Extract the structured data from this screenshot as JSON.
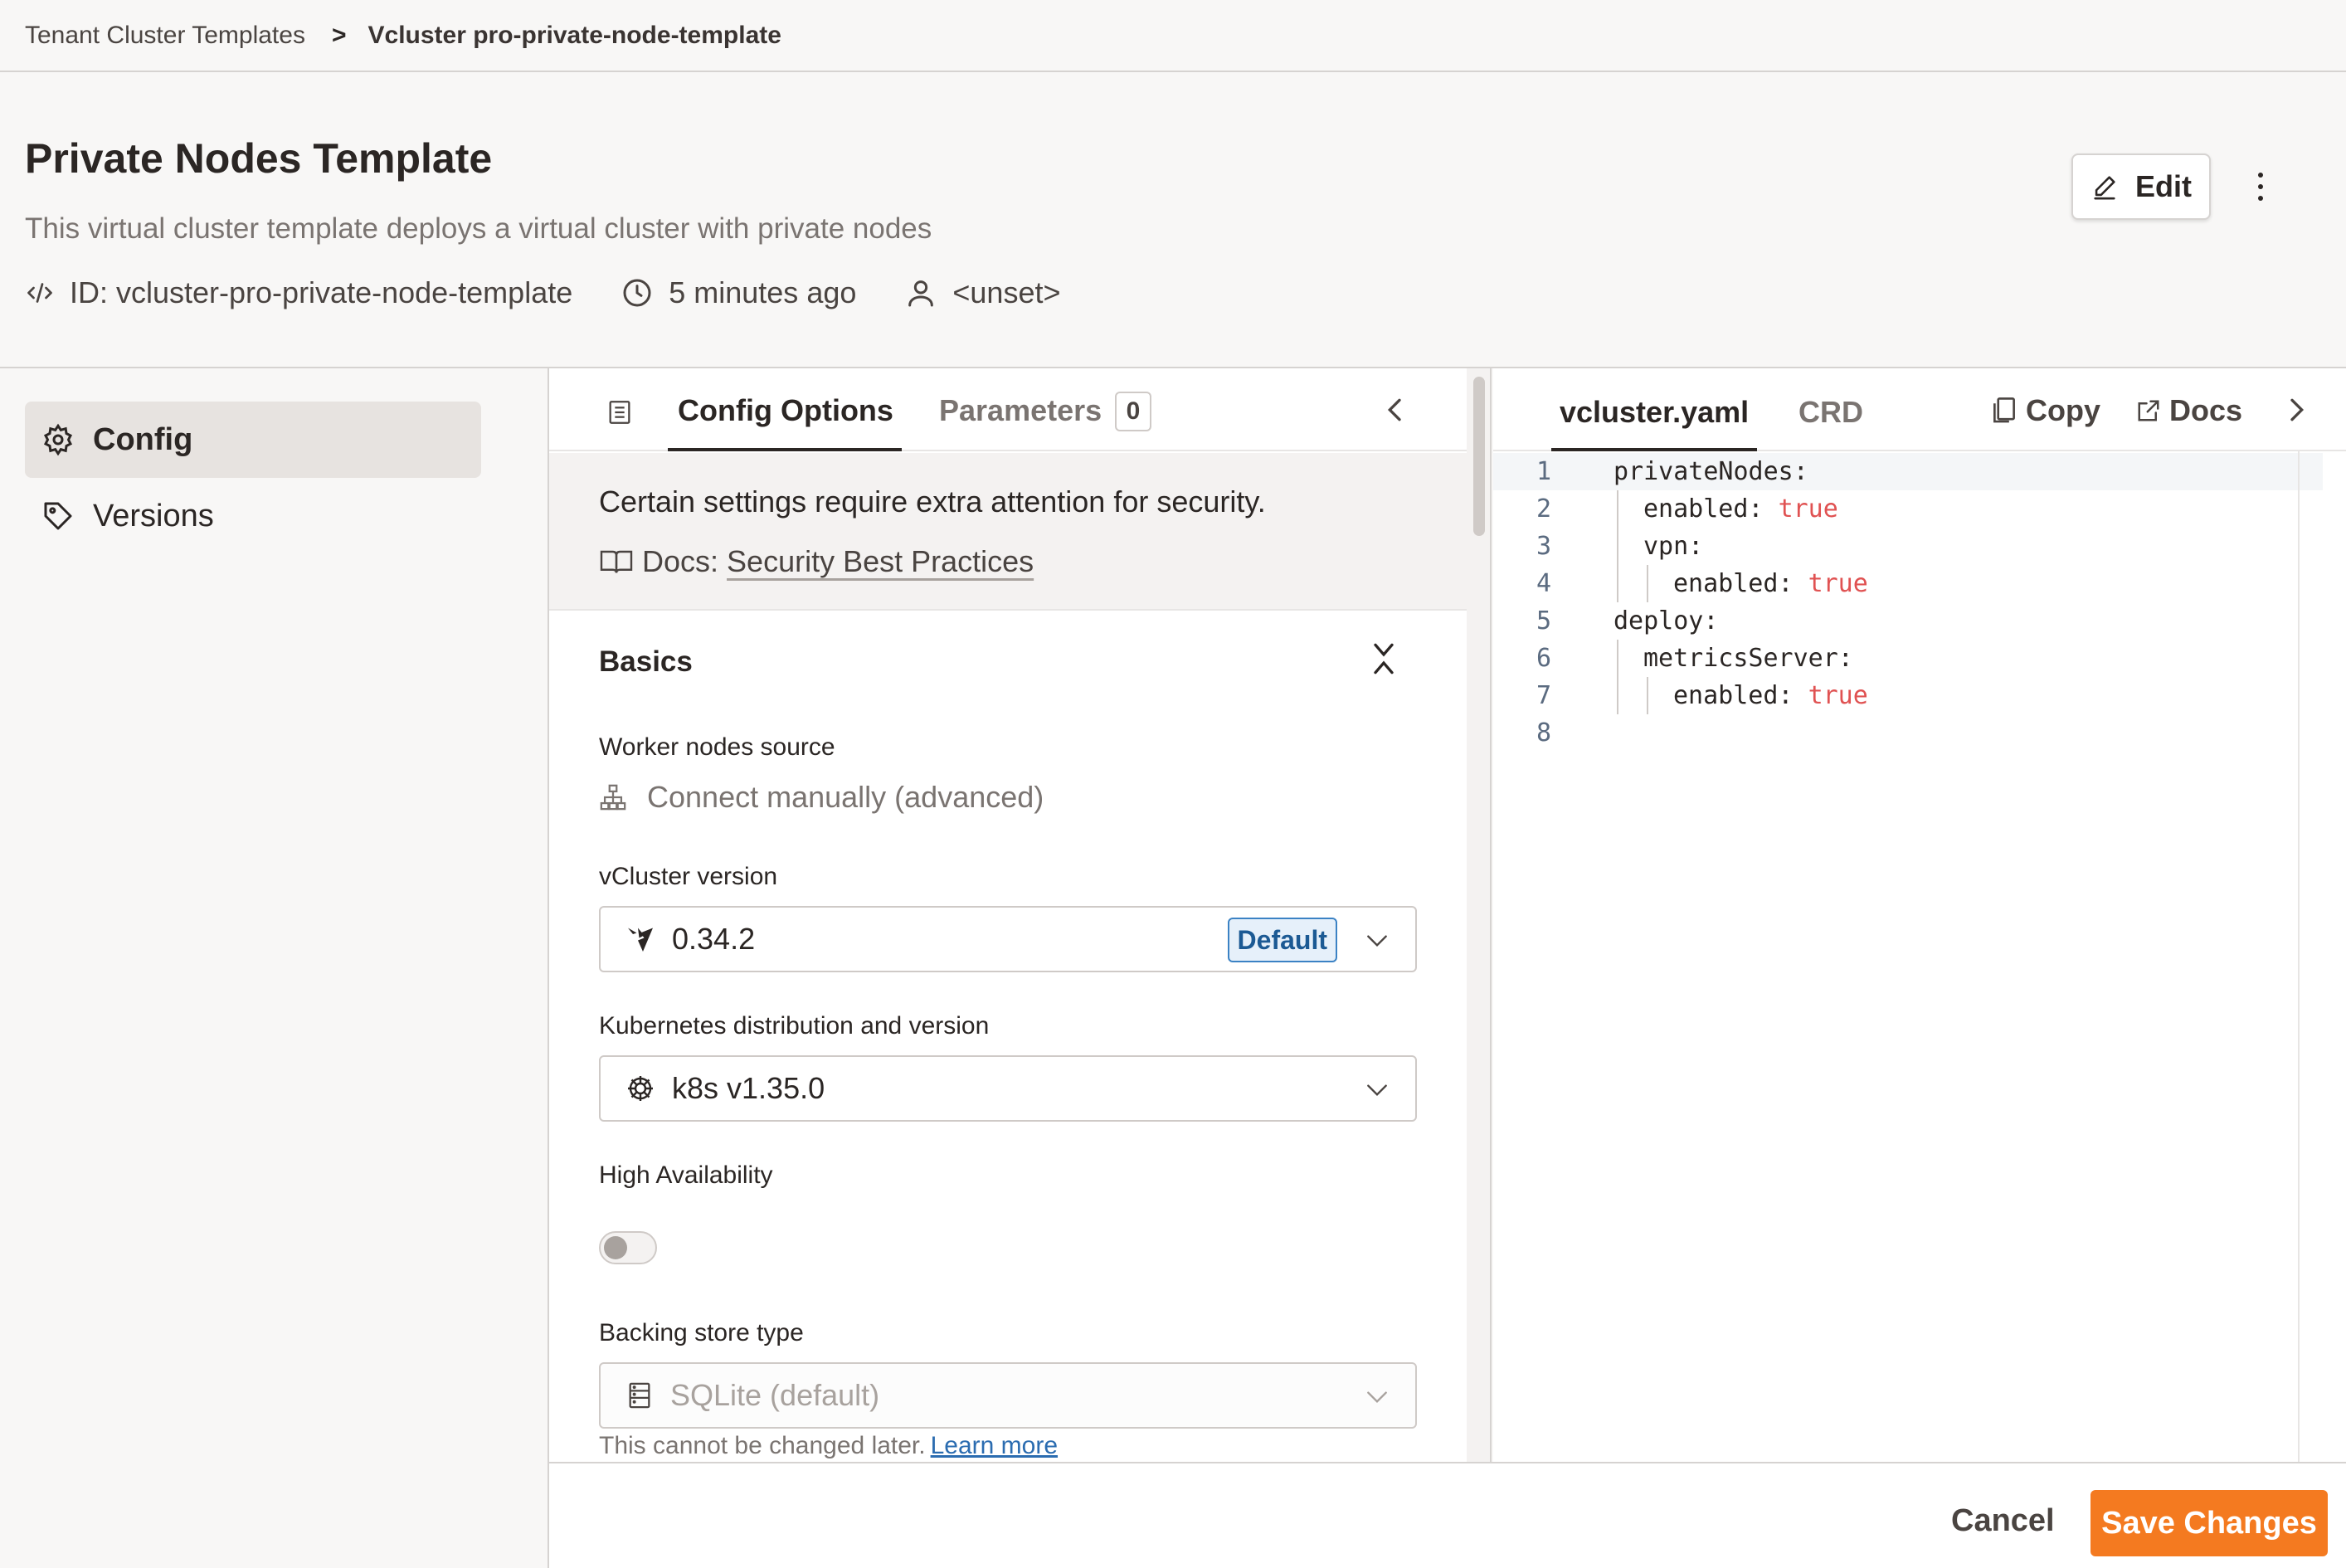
{
  "breadcrumb": {
    "parent": "Tenant Cluster Templates",
    "separator": ">",
    "current": "Vcluster pro-private-node-template"
  },
  "header": {
    "title": "Private Nodes Template",
    "subtitle": "This virtual cluster template deploys a virtual cluster with private nodes",
    "id_text": "ID: vcluster-pro-private-node-template",
    "time_text": "5 minutes ago",
    "owner_text": "<unset>",
    "edit_label": "Edit"
  },
  "sidebar": {
    "items": [
      {
        "label": "Config",
        "icon": "gear-icon",
        "active": true
      },
      {
        "label": "Versions",
        "icon": "tag-icon",
        "active": false
      }
    ]
  },
  "config": {
    "tabs": {
      "active": "Config Options",
      "inactive": "Parameters",
      "param_count": "0"
    },
    "security": {
      "text": "Certain settings require extra attention for security.",
      "docs_prefix": "Docs:",
      "docs_link": "Security Best Practices"
    },
    "section_title": "Basics",
    "worker_nodes": {
      "label": "Worker nodes source",
      "value": "Connect manually (advanced)"
    },
    "vcluster_version": {
      "label": "vCluster version",
      "value": "0.34.2",
      "badge": "Default"
    },
    "k8s": {
      "label": "Kubernetes distribution and version",
      "value": "k8s v1.35.0"
    },
    "ha": {
      "label": "High Availability",
      "enabled": false
    },
    "backing_store": {
      "label": "Backing store type",
      "value": "SQLite (default)",
      "hint": "This cannot be changed later.",
      "hint_link": "Learn more"
    }
  },
  "yaml": {
    "tabs": {
      "active": "vcluster.yaml",
      "inactive": "CRD"
    },
    "copy_label": "Copy",
    "docs_label": "Docs",
    "lines": [
      {
        "num": "1",
        "key": "privateNodes:",
        "val": ""
      },
      {
        "num": "2",
        "key": "enabled: ",
        "val": "true"
      },
      {
        "num": "3",
        "key": "vpn:",
        "val": ""
      },
      {
        "num": "4",
        "key": "enabled: ",
        "val": "true"
      },
      {
        "num": "5",
        "key": "deploy:",
        "val": ""
      },
      {
        "num": "6",
        "key": "metricsServer:",
        "val": ""
      },
      {
        "num": "7",
        "key": "enabled: ",
        "val": "true"
      },
      {
        "num": "8",
        "key": "",
        "val": ""
      }
    ]
  },
  "footer": {
    "cancel_label": "Cancel",
    "save_label": "Save Changes"
  },
  "colors": {
    "accent": "#f47a20",
    "yaml_value": "#e05252",
    "badge_blue": "#3b82c4"
  }
}
